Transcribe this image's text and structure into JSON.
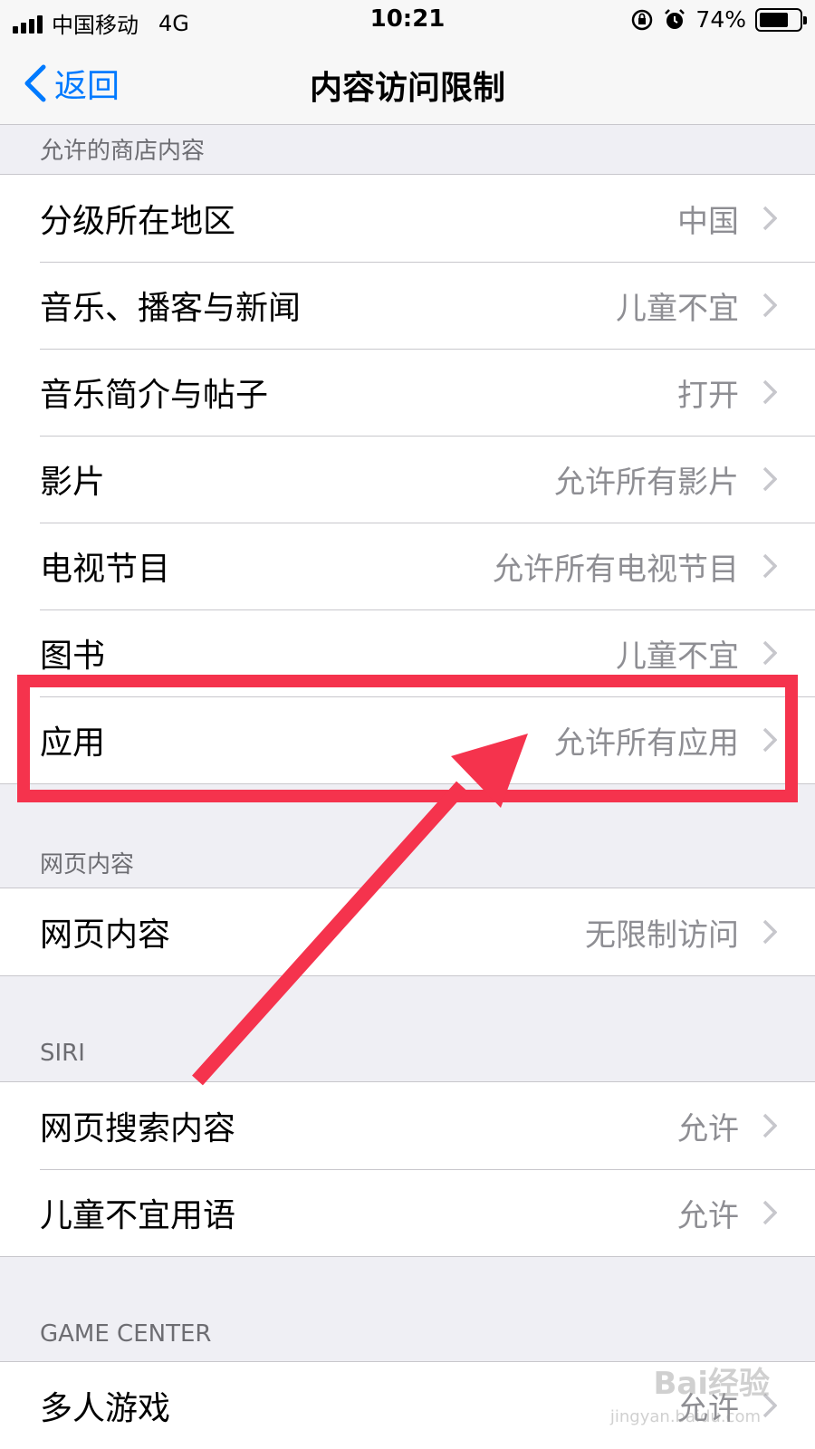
{
  "status_bar": {
    "carrier": "中国移动",
    "network": "4G",
    "time": "10:21",
    "battery": "74%",
    "battery_level": 0.74
  },
  "nav": {
    "back_label": "返回",
    "title": "内容访问限制"
  },
  "sections": {
    "store": {
      "header": "允许的商店内容",
      "rows": [
        {
          "label": "分级所在地区",
          "value": "中国"
        },
        {
          "label": "音乐、播客与新闻",
          "value": "儿童不宜"
        },
        {
          "label": "音乐简介与帖子",
          "value": "打开"
        },
        {
          "label": "影片",
          "value": "允许所有影片"
        },
        {
          "label": "电视节目",
          "value": "允许所有电视节目"
        },
        {
          "label": "图书",
          "value": "儿童不宜"
        },
        {
          "label": "应用",
          "value": "允许所有应用"
        }
      ]
    },
    "web": {
      "header": "网页内容",
      "rows": [
        {
          "label": "网页内容",
          "value": "无限制访问"
        }
      ]
    },
    "siri": {
      "header": "SIRI",
      "rows": [
        {
          "label": "网页搜索内容",
          "value": "允许"
        },
        {
          "label": "儿童不宜用语",
          "value": "允许"
        }
      ]
    },
    "game_center": {
      "header": "GAME CENTER",
      "rows": [
        {
          "label": "多人游戏",
          "value": "允许"
        }
      ]
    }
  },
  "watermark": {
    "brand": "Bai经验",
    "domain": "jingyan.baidu.com"
  },
  "colors": {
    "accent": "#007aff",
    "annotation": "#f5334d",
    "background": "#efeff4",
    "secondary_text": "#8e8e93"
  }
}
